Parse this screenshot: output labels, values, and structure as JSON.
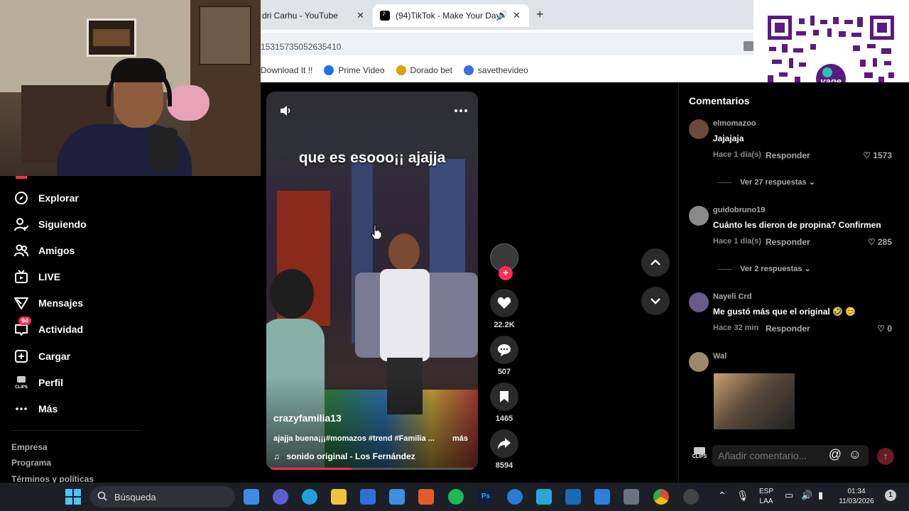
{
  "browser": {
    "tabs": [
      {
        "label": "dri Carhu - YouTube",
        "active": false
      },
      {
        "label": "(94)TikTok - Make Your Day",
        "active": true
      }
    ],
    "new_tab": "+",
    "close_glyph": "✕",
    "url": "15315735052635410",
    "bookmarks": [
      {
        "label": "Download It !!",
        "color": "#e44"
      },
      {
        "label": "Prime Video",
        "color": "#1a73e8"
      },
      {
        "label": "Dorado bet",
        "color": "#d9a400"
      },
      {
        "label": "savethevideo",
        "color": "#3b6fe0"
      }
    ]
  },
  "sidebar": {
    "items": [
      {
        "label": "Explorar",
        "icon": "compass-icon"
      },
      {
        "label": "Siguiendo",
        "icon": "user-follow-icon"
      },
      {
        "label": "Amigos",
        "icon": "friends-icon"
      },
      {
        "label": "LIVE",
        "icon": "live-icon"
      },
      {
        "label": "Mensajes",
        "icon": "send-icon"
      },
      {
        "label": "Actividad",
        "icon": "inbox-icon",
        "badge": "94"
      },
      {
        "label": "Cargar",
        "icon": "upload-icon"
      },
      {
        "label": "Perfil",
        "icon": "profile-icon"
      },
      {
        "label": "Más",
        "icon": "more-icon"
      }
    ],
    "footer": [
      "Empresa",
      "Programa",
      "Términos y políticas"
    ]
  },
  "video": {
    "overlay_text": "que es esooo¡¡ ajajja",
    "username": "crazyfamilia13",
    "description": "ajajja buena¡¡¡#momazos #trend #Familia ...",
    "more_label": "más",
    "sound": "sonido original - Los Fernández",
    "progress": 0.4
  },
  "actions": {
    "likes": "22.2K",
    "comments": "507",
    "saves": "1465",
    "shares": "8594"
  },
  "comments_panel": {
    "title": "Comentarios",
    "comments": [
      {
        "user": "elmomazoo",
        "text": "Jajajaja",
        "meta": "Hace 1 día(s)",
        "reply": "Responder",
        "likes": "1573"
      },
      {
        "user": "guidobruno19",
        "text": "Cuánto les dieron de propina? Confirmen",
        "meta": "Hace 1 día(s)",
        "reply": "Responder",
        "likes": "285"
      },
      {
        "user": "Nayeli Crd",
        "text": "Me gustó más que el original 🤣 😊",
        "meta": "Hace 32 min",
        "reply": "Responder",
        "likes": "0"
      },
      {
        "user": "Wal",
        "text": "",
        "meta": "",
        "reply": "",
        "likes": ""
      }
    ],
    "view_replies": [
      "Ver 27 respuestas",
      "Ver 2 respuestas"
    ],
    "add_comment_placeholder": "Añadir comentario...",
    "clips_label": "CLIPS"
  },
  "taskbar": {
    "search_placeholder": "Búsqueda",
    "lang_top": "ESP",
    "lang_bottom": "LAA",
    "time": "01:34",
    "date": "11/03/2026"
  },
  "colors": {
    "accent": "#fe2c55",
    "background": "#000000"
  }
}
